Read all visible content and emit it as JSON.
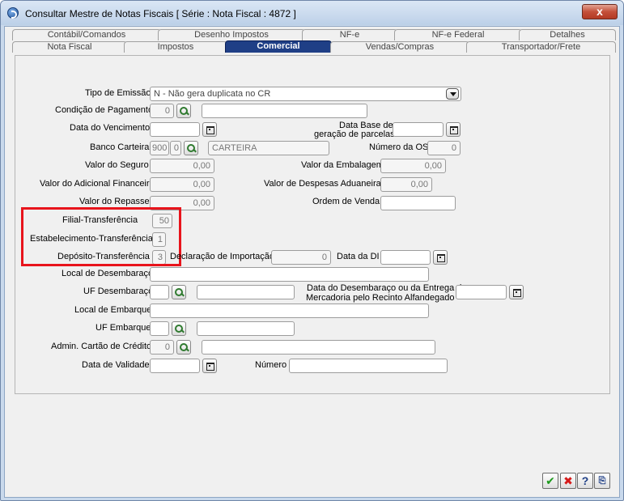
{
  "window": {
    "title": "Consultar Mestre de Notas Fiscais [ Série :     Nota Fiscal : 4872 ]",
    "close_glyph": "x"
  },
  "tabs_row1": [
    "Contábil/Comandos",
    "Desenho Impostos",
    "NF-e",
    "NF-e Federal",
    "Detalhes"
  ],
  "tabs_row2": [
    "Nota Fiscal",
    "Impostos",
    "Comercial",
    "Vendas/Compras",
    "Transportador/Frete"
  ],
  "active_tab": "Comercial",
  "form": {
    "tipo_emissao": {
      "label": "Tipo de Emissão",
      "value": "N - Não gera duplicata no CR"
    },
    "condicao_pagamento": {
      "label": "Condição de Pagamento",
      "code": "0",
      "desc": ""
    },
    "data_vencimento": {
      "label": "Data do Vencimento",
      "value": ""
    },
    "data_base": {
      "label_line1": "Data Base de",
      "label_line2": "geração de parcelas",
      "value": ""
    },
    "banco_carteira": {
      "label": "Banco Carteira",
      "banco": "900",
      "carteira": "0",
      "desc": "CARTEIRA"
    },
    "numero_os": {
      "label": "Número da OS",
      "value": "0"
    },
    "valor_seguro": {
      "label": "Valor do Seguro",
      "value": "0,00"
    },
    "valor_embalagem": {
      "label": "Valor da Embalagem",
      "value": "0,00"
    },
    "valor_adicional_financeiro": {
      "label": "Valor do Adicional Financeiro",
      "value": "0,00"
    },
    "valor_despesas_aduaneiras": {
      "label": "Valor de Despesas Aduaneiras",
      "value": "0,00"
    },
    "valor_repasse": {
      "label": "Valor do Repasse",
      "value": "0,00"
    },
    "ordem_venda": {
      "label": "Ordem de Venda",
      "value": ""
    },
    "filial_transferencia": {
      "label": "Filial-Transferência",
      "value": "50"
    },
    "estabelecimento_transferencia": {
      "label": "Estabelecimento-Transferência",
      "value": "1"
    },
    "deposito_transferencia": {
      "label": "Depósito-Transferência",
      "value": "3"
    },
    "declaracao_importacao": {
      "label": "Declaração de Importação",
      "value": "0"
    },
    "data_di": {
      "label": "Data da DI",
      "value": ""
    },
    "local_desembaraco": {
      "label": "Local de Desembaraço",
      "value": ""
    },
    "uf_desembaraco": {
      "label": "UF Desembaraço",
      "code": "",
      "desc": ""
    },
    "data_desembaraco": {
      "label_line1": "Data do Desembaraço ou da Entrega da",
      "label_line2": "Mercadoria pelo Recinto Alfandegado",
      "value": ""
    },
    "local_embarque": {
      "label": "Local de Embarque",
      "value": ""
    },
    "uf_embarque": {
      "label": "UF Embarque",
      "code": "",
      "desc": ""
    },
    "admin_cartao": {
      "label": "Admin. Cartão de Crédito",
      "code": "0",
      "desc": ""
    },
    "data_validade": {
      "label": "Data de Validade",
      "value": ""
    },
    "numero": {
      "label": "Número",
      "value": ""
    }
  },
  "footer_buttons": {
    "ok": "✔",
    "cancel": "✖",
    "help": "?",
    "exit": "⎘"
  },
  "colors": {
    "highlight": "#e8141c",
    "active_tab": "#1f3f86",
    "ok": "#1c9a1c",
    "cancel": "#d61a1a"
  }
}
